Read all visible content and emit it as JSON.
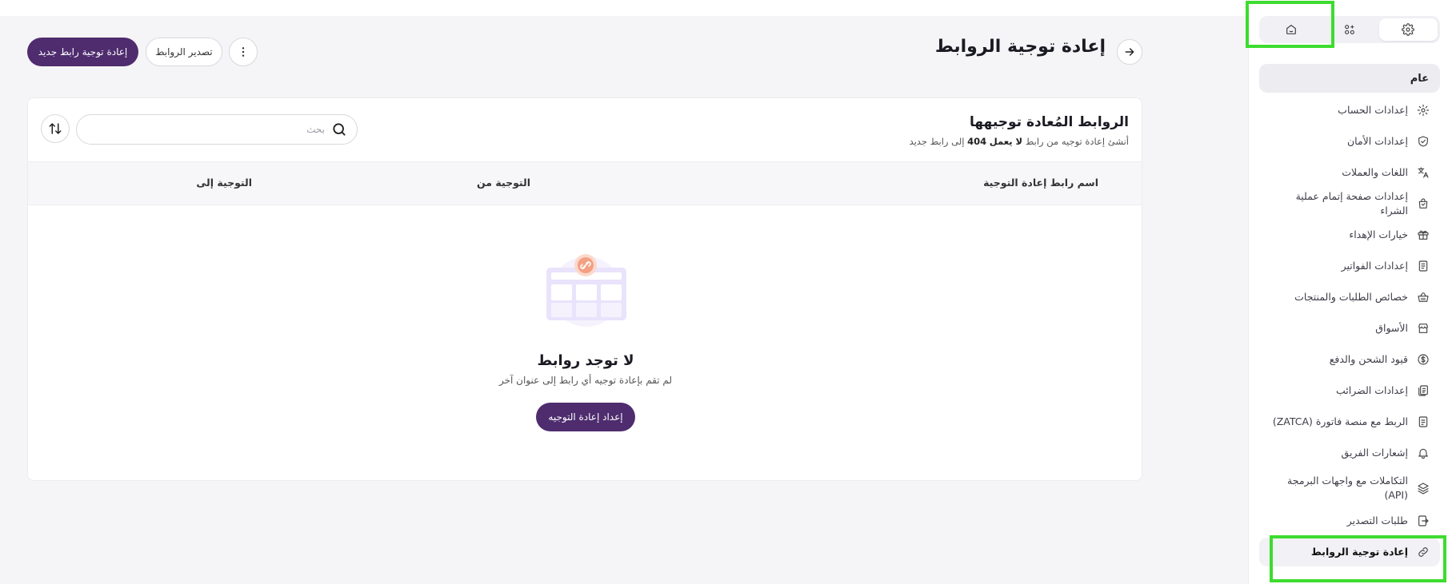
{
  "page": {
    "title": "إعادة توجية الروابط",
    "primary_button": "إعادة توجية رابط جديد",
    "export_button": "تصدير الروابط"
  },
  "sidebar": {
    "section_title": "عام",
    "items": [
      {
        "label": "إعدادات الحساب",
        "icon": "gear-icon"
      },
      {
        "label": "إعدادات الأمان",
        "icon": "shield-check-icon"
      },
      {
        "label": "اللغات والعملات",
        "icon": "translate-icon"
      },
      {
        "label": "إعدادات صفحة إتمام عملية الشراء",
        "icon": "shopping-bag-icon"
      },
      {
        "label": "خيارات الإهداء",
        "icon": "gift-icon"
      },
      {
        "label": "إعدادات الفواتير",
        "icon": "invoice-icon"
      },
      {
        "label": "خصائص الطلبات والمنتجات",
        "icon": "basket-icon"
      },
      {
        "label": "الأسواق",
        "icon": "store-icon"
      },
      {
        "label": "قيود الشحن والدفع",
        "icon": "dollar-circle-icon"
      },
      {
        "label": "إعدادات الضرائب",
        "icon": "tax-receipt-icon"
      },
      {
        "label": "الربط مع منصة فاتورة (ZATCA)",
        "icon": "document-icon"
      },
      {
        "label": "إشعارات الفريق",
        "icon": "bell-icon"
      },
      {
        "label": "التكاملات مع واجهات البرمجة (API)",
        "icon": "layers-icon"
      },
      {
        "label": "طلبات التصدير",
        "icon": "export-icon"
      },
      {
        "label": "إعادة توجية الروابط",
        "icon": "link-icon",
        "active": true
      }
    ]
  },
  "card": {
    "title": "الروابط المُعادة توجيهها",
    "subtitle_prefix": "أنشئ إعادة توجيه من رابط",
    "subtitle_bold_1": "لا يعمل",
    "subtitle_bold_2": "404",
    "subtitle_suffix": "إلى رابط جديد",
    "search_placeholder": "بحث",
    "columns": {
      "name": "اسم رابط إعادة التوجية",
      "from": "التوجية من",
      "to": "التوجية إلى"
    },
    "empty_title": "لا توجد روابط",
    "empty_subtitle": "لم تقم بإعادة توجيه أي رابط إلى عنوان آخر",
    "empty_button": "إعداد إعادة التوجيه"
  },
  "colors": {
    "primary": "#4e2c6e",
    "highlight": "#3ddc2f",
    "illustration": "#e9e3fb",
    "illustration_accent": "#f4a083"
  }
}
